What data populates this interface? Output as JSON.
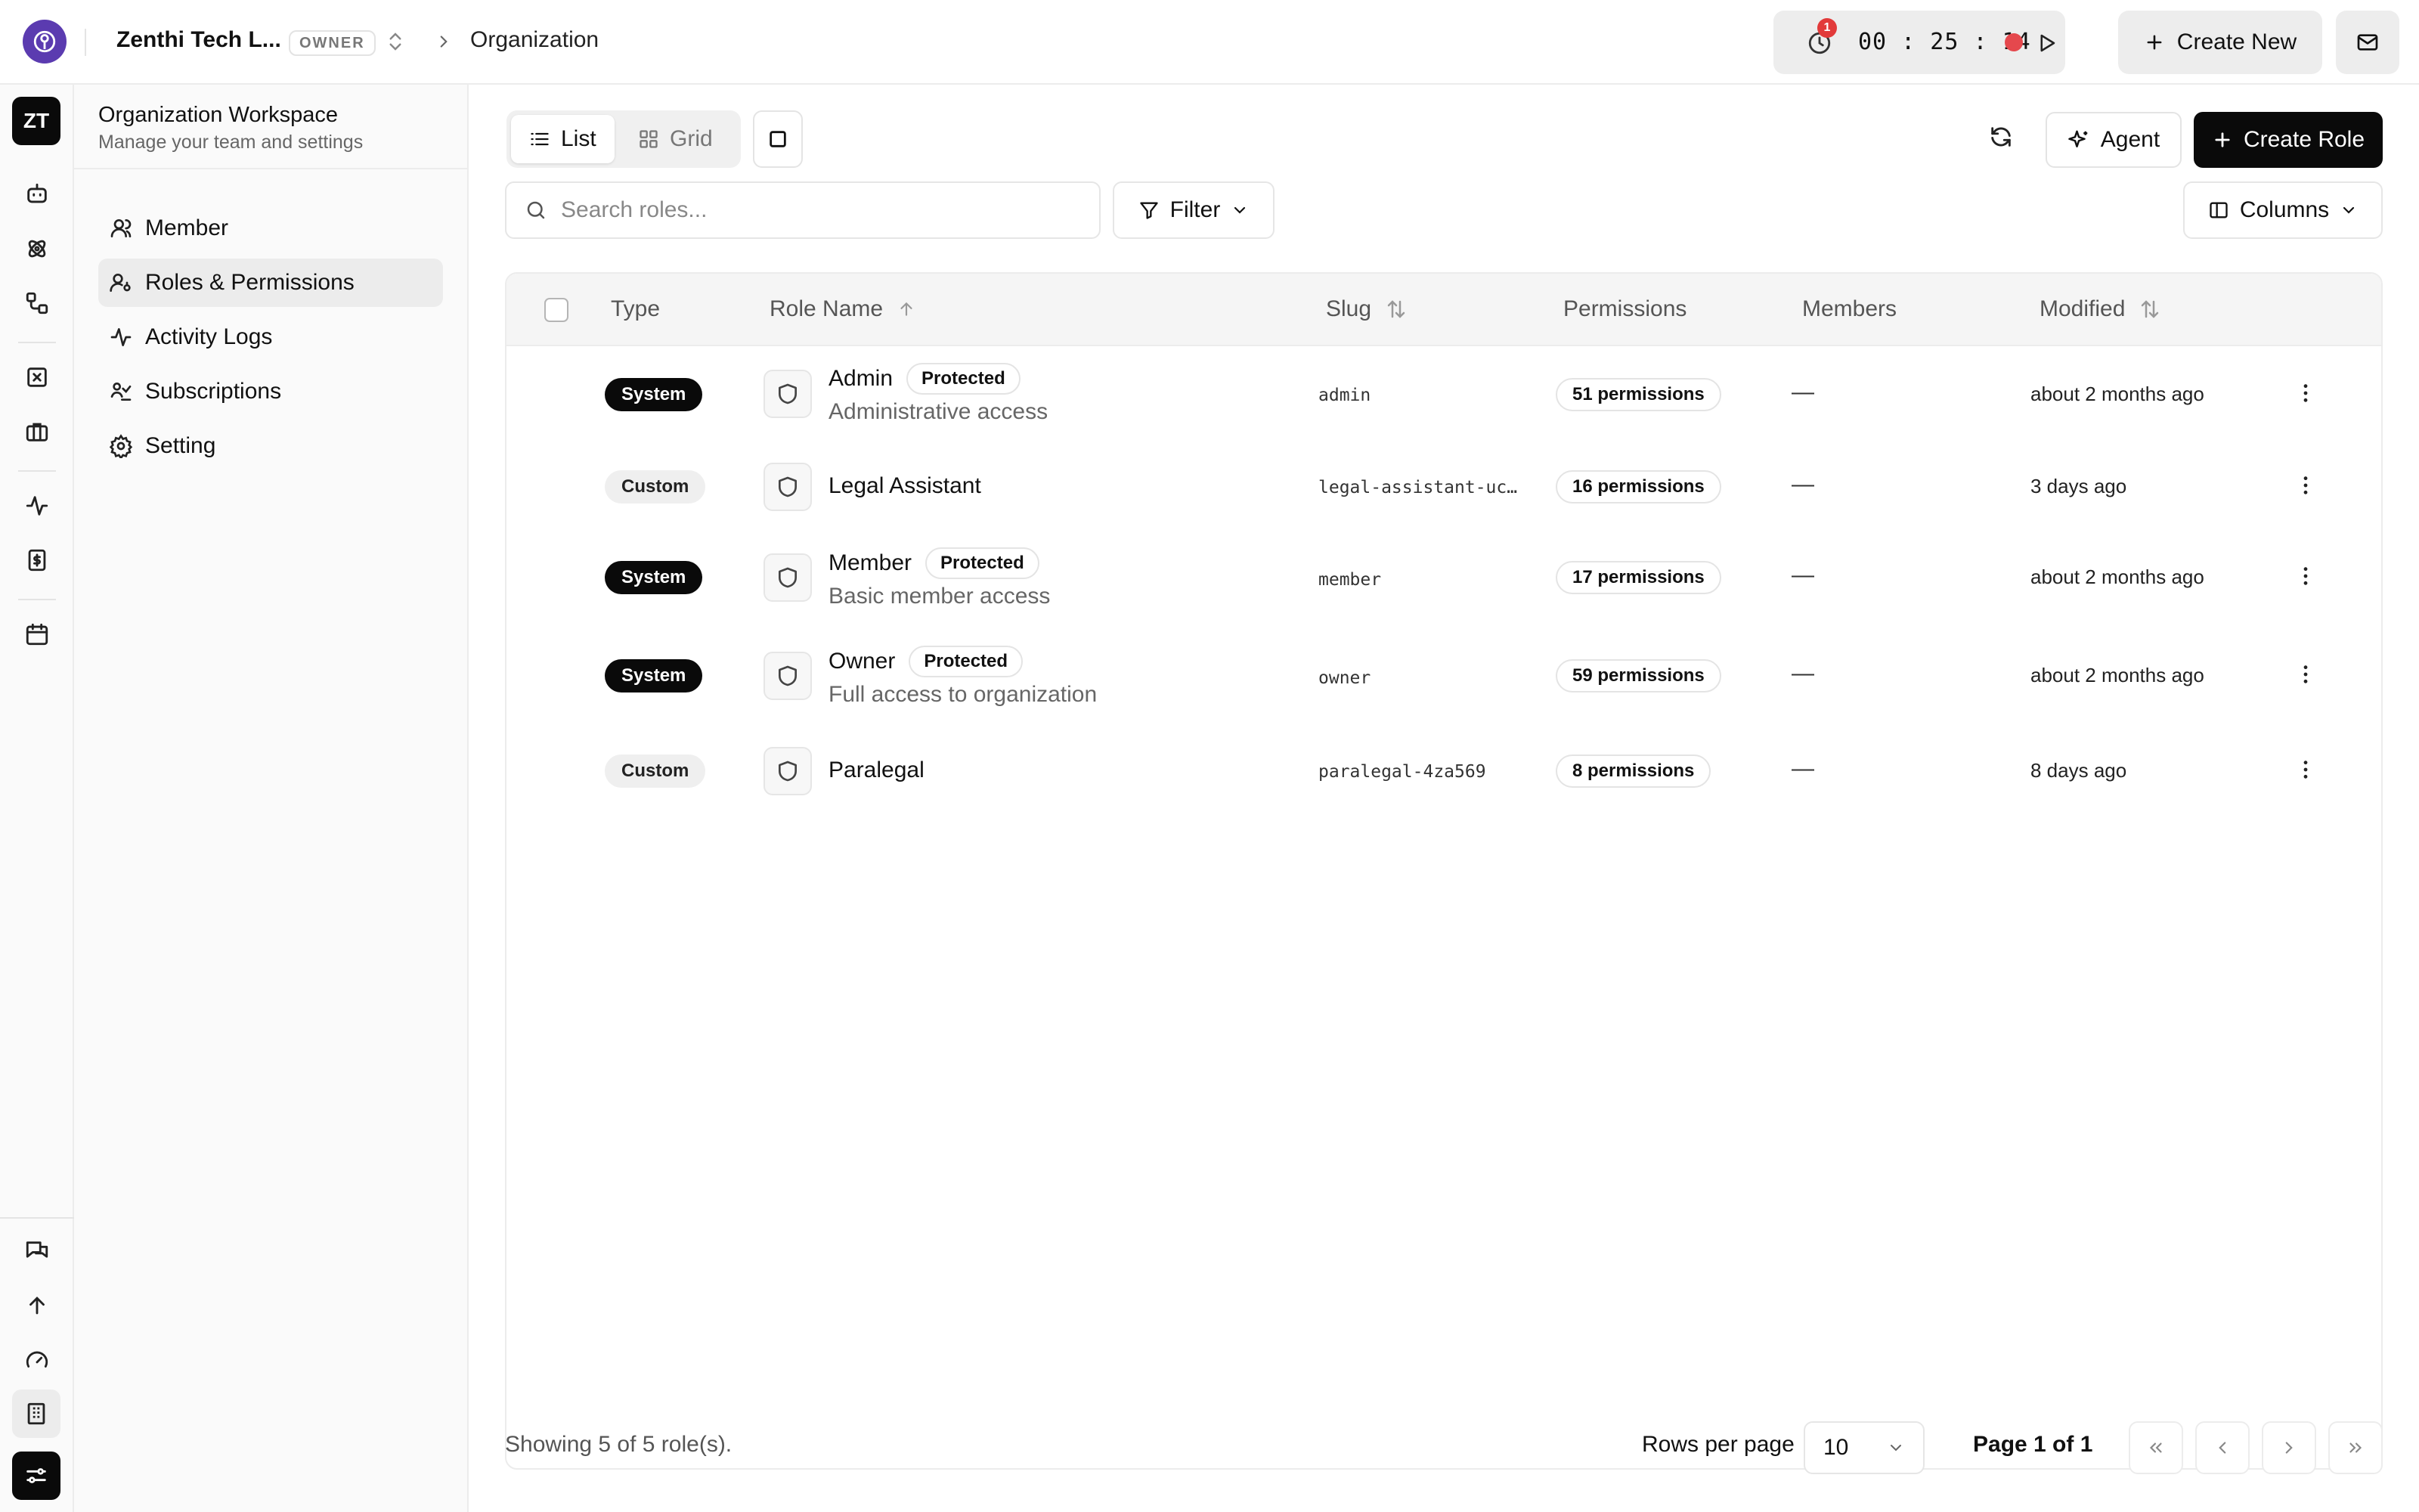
{
  "topbar": {
    "org_name": "Zenthi Tech L...",
    "org_role": "OWNER",
    "breadcrumb_current": "Organization",
    "timer": {
      "notification_count": "1",
      "time": "00 : 25 : 14"
    },
    "create_new_label": "Create New"
  },
  "rail": {
    "workspace_initials": "ZT"
  },
  "sidebar": {
    "title": "Organization Workspace",
    "subtitle": "Manage your team and settings",
    "items": [
      {
        "label": "Member",
        "icon": "user-icon",
        "active": false
      },
      {
        "label": "Roles & Permissions",
        "icon": "user-key-icon",
        "active": true
      },
      {
        "label": "Activity Logs",
        "icon": "activity-icon",
        "active": false
      },
      {
        "label": "Subscriptions",
        "icon": "subscriptions-icon",
        "active": false
      },
      {
        "label": "Setting",
        "icon": "gear-icon",
        "active": false
      }
    ]
  },
  "toolbar": {
    "view_list": "List",
    "view_grid": "Grid",
    "agent_label": "Agent",
    "create_role_label": "Create Role",
    "search_placeholder": "Search roles...",
    "filter_label": "Filter",
    "columns_label": "Columns"
  },
  "table": {
    "columns": {
      "type": "Type",
      "role_name": "Role Name",
      "slug": "Slug",
      "permissions": "Permissions",
      "members": "Members",
      "modified": "Modified"
    },
    "rows": [
      {
        "type": "System",
        "name": "Admin",
        "protected": "Protected",
        "description": "Administrative access",
        "slug": "admin",
        "permissions": "51 permissions",
        "members": "—",
        "modified": "about 2 months ago"
      },
      {
        "type": "Custom",
        "name": "Legal Assistant",
        "protected": "",
        "description": "",
        "slug": "legal-assistant-ucs…",
        "permissions": "16 permissions",
        "members": "—",
        "modified": "3 days ago"
      },
      {
        "type": "System",
        "name": "Member",
        "protected": "Protected",
        "description": "Basic member access",
        "slug": "member",
        "permissions": "17 permissions",
        "members": "—",
        "modified": "about 2 months ago"
      },
      {
        "type": "System",
        "name": "Owner",
        "protected": "Protected",
        "description": "Full access to organization",
        "slug": "owner",
        "permissions": "59 permissions",
        "members": "—",
        "modified": "about 2 months ago"
      },
      {
        "type": "Custom",
        "name": "Paralegal",
        "protected": "",
        "description": "",
        "slug": "paralegal-4za569",
        "permissions": "8 permissions",
        "members": "—",
        "modified": "8 days ago"
      }
    ]
  },
  "footer": {
    "showing": "Showing 5 of 5 role(s).",
    "rows_per_page_label": "Rows per page",
    "rows_per_page_value": "10",
    "page_label": "Page 1 of 1"
  },
  "colors": {
    "accent": "#0a0a0a",
    "logo": "#5b3bb0",
    "record": "#e5484d",
    "badge": "#e23a3a"
  }
}
